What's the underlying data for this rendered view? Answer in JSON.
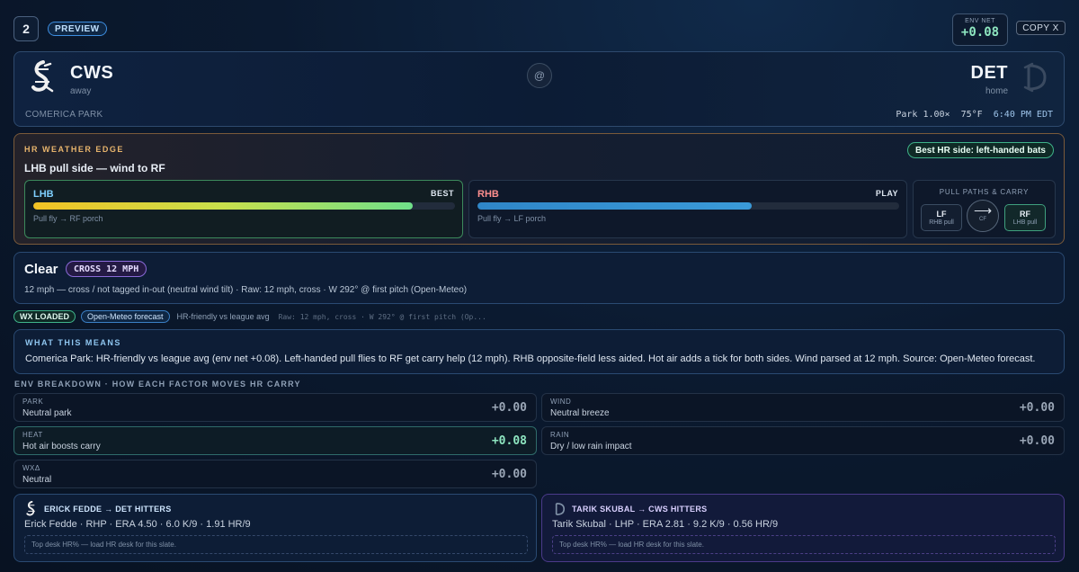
{
  "header": {
    "game_number": "2",
    "status_badge": "PREVIEW",
    "env_net_label": "ENV NET",
    "env_net_value": "+0.08",
    "copy_button": "COPY X"
  },
  "matchup": {
    "away": {
      "abbr": "CWS",
      "role": "away",
      "logo_icon": "white-sox-logo-icon"
    },
    "home": {
      "abbr": "DET",
      "role": "home",
      "logo_icon": "tigers-logo-icon"
    },
    "at_symbol": "@",
    "venue": "COMERICA PARK",
    "park_factor": "Park 1.00×",
    "temperature": "75°F",
    "first_pitch_time": "6:40 PM EDT"
  },
  "hr_edge": {
    "title": "HR WEATHER EDGE",
    "subtitle": "LHB pull side — wind to RF",
    "best_chip": "Best HR side: left-handed bats",
    "lhb": {
      "name": "LHB",
      "tag": "BEST",
      "level_pct": 90,
      "desc": "Pull fly → RF porch"
    },
    "rhb": {
      "name": "RHB",
      "tag": "PLAY",
      "level_pct": 65,
      "desc": "Pull fly → LF porch"
    },
    "paths": {
      "title": "PULL PATHS & CARRY",
      "lf": {
        "label": "LF",
        "sub": "RHB pull"
      },
      "cf": {
        "arrow": "⟶",
        "label": "CF"
      },
      "rf": {
        "label": "RF",
        "sub": "LHB pull"
      }
    },
    "colors": {
      "lhb": "#7fd0ff",
      "rhb": "#ff8f8f",
      "accent": "#e7b46c"
    }
  },
  "conditions": {
    "sky": "Clear",
    "wind_chip": "CROSS 12 MPH",
    "detail": "12 mph — cross / not tagged in-out (neutral wind tilt) · Raw: 12 mph, cross · W 292° @ first pitch (Open-Meteo)"
  },
  "chips": {
    "wx_loaded": "WX LOADED",
    "source": "Open-Meteo forecast",
    "park_note": "HR-friendly vs league avg",
    "raw": "Raw: 12 mph, cross · W 292° @ first pitch (Op..."
  },
  "means": {
    "title": "WHAT THIS MEANS",
    "text": "Comerica Park: HR-friendly vs league avg (env net +0.08). Left-handed pull flies to RF get carry help (12 mph). RHB opposite-field less aided. Hot air adds a tick for both sides. Wind parsed at 12 mph. Source: Open-Meteo forecast."
  },
  "env_breakdown": {
    "title": "ENV BREAKDOWN · HOW EACH FACTOR MOVES HR CARRY",
    "factors": [
      {
        "name": "PARK",
        "desc": "Neutral park",
        "value": "+0.00"
      },
      {
        "name": "WIND",
        "desc": "Neutral breeze",
        "value": "+0.00"
      },
      {
        "name": "HEAT",
        "desc": "Hot air boosts carry",
        "value": "+0.08"
      },
      {
        "name": "RAIN",
        "desc": "Dry / low rain impact",
        "value": "+0.00"
      },
      {
        "name": "WXΔ",
        "desc": "Neutral",
        "value": "+0.00"
      }
    ]
  },
  "pitchers": [
    {
      "title": "ERICK FEDDE → DET HITTERS",
      "line": "Erick Fedde · RHP · ERA 4.50 · 6.0 K/9 · 1.91 HR/9",
      "desk": "Top desk HR% — load HR desk for this slate."
    },
    {
      "title": "TARIK SKUBAL → CWS HITTERS",
      "line": "Tarik Skubal · LHP · ERA 2.81 · 9.2 K/9 · 0.56 HR/9",
      "desk": "Top desk HR% — load HR desk for this slate."
    }
  ]
}
